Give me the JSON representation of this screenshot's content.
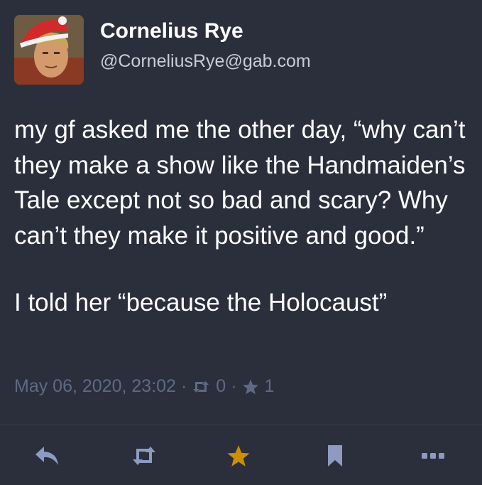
{
  "author": {
    "display_name": "Cornelius Rye",
    "handle": "@CorneliusRye@gab.com",
    "avatar_icon": "avatar-photo-santa-hat"
  },
  "status": {
    "paragraphs": [
      "my gf asked me the other day, “why can’t they make a show like the Handmaiden’s Tale except not so bad and scary? Why can’t they make it positive and good.”",
      "I told her “because the Holocaust”"
    ],
    "timestamp": "May 06, 2020, 23:02",
    "separator": "·",
    "reblogs_count": "0",
    "favourites_count": "1"
  },
  "actions": [
    {
      "name": "reply",
      "icon": "reply-icon"
    },
    {
      "name": "boost",
      "icon": "retweet-icon"
    },
    {
      "name": "favourite",
      "icon": "star-icon",
      "active": true
    },
    {
      "name": "bookmark",
      "icon": "bookmark-icon"
    },
    {
      "name": "more",
      "icon": "ellipsis-icon"
    }
  ],
  "colors": {
    "background": "#2b2f3c",
    "text": "#ffffff",
    "muted": "#606984",
    "icon": "#8d9ac2",
    "favourite_active": "#ca8f04"
  }
}
